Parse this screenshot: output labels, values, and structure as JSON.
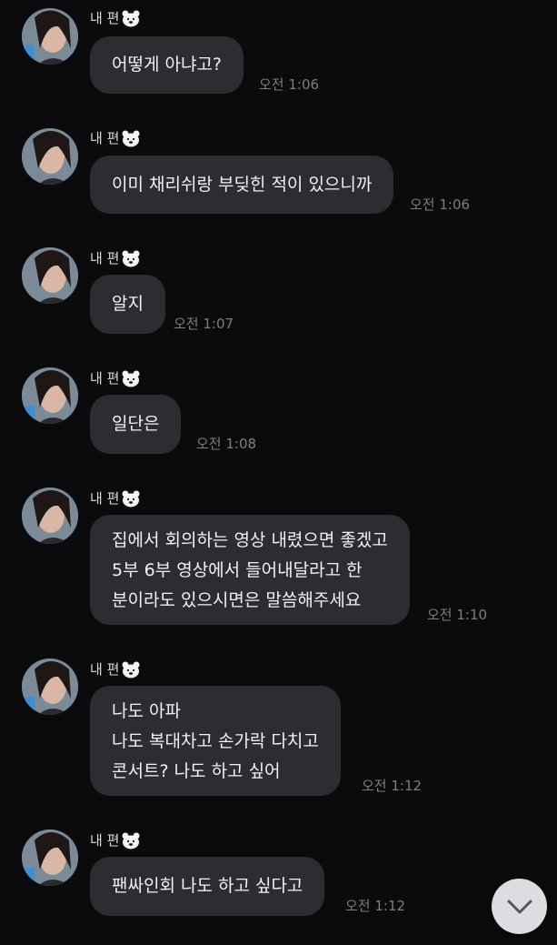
{
  "colors": {
    "background": "#0b0b0d",
    "bubble": "#2c2d31",
    "text": "#f1f1f3",
    "sender": "#d9d9dc",
    "time": "#7d7e83",
    "scroll_button": "#dcdde1"
  },
  "sender_name": "내 편",
  "sender_emoji_icon": "polar-bear-icon",
  "messages": [
    {
      "lines": [
        "어떻게 아냐고?"
      ],
      "time": "오전 1:06"
    },
    {
      "lines": [
        "이미 채리쉬랑 부딪힌 적이 있으니까"
      ],
      "time": "오전 1:06"
    },
    {
      "lines": [
        "알지"
      ],
      "time": "오전 1:07"
    },
    {
      "lines": [
        "일단은"
      ],
      "time": "오전 1:08"
    },
    {
      "lines": [
        "집에서 회의하는 영상 내렸으면 좋겠고",
        "5부 6부 영상에서 들어내달라고  한",
        "분이라도 있으시면은 말씀해주세요"
      ],
      "time": "오전 1:10"
    },
    {
      "lines": [
        "나도 아파",
        "나도 복대차고 손가락 다치고",
        "콘서트? 나도 하고 싶어"
      ],
      "time": "오전 1:12"
    },
    {
      "lines": [
        "팬싸인회 나도 하고 싶다고"
      ],
      "time": "오전 1:12"
    }
  ],
  "scroll_button_icon": "chevron-down-icon"
}
